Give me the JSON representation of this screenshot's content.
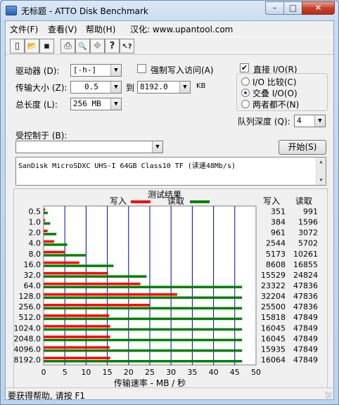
{
  "window": {
    "title": "无标题 - ATTO Disk Benchmark"
  },
  "menu": [
    "文件(F)",
    "查看(V)",
    "帮助(H)",
    "汉化: www.upantool.com"
  ],
  "toolbar": [
    {
      "name": "new-icon",
      "glyph": "▯"
    },
    {
      "name": "open-icon",
      "glyph": "📂"
    },
    {
      "name": "save-icon",
      "glyph": "▪"
    },
    {
      "name": "print-icon",
      "glyph": "⎙"
    },
    {
      "name": "print-preview-icon",
      "glyph": "🔍"
    },
    {
      "name": "move-icon",
      "glyph": "✥"
    },
    {
      "name": "help-icon",
      "glyph": "?"
    },
    {
      "name": "context-help-icon",
      "glyph": "↖?"
    }
  ],
  "settings": {
    "drive_label": "驱动器 (D):",
    "drive_value": "[-h-]",
    "force_write_label": "强制写入访问(A)",
    "force_write_checked": false,
    "transfer_label": "传输大小 (Z):",
    "transfer_from": "0.5",
    "to_label": "到",
    "transfer_to": "8192.0",
    "kb_label": "KB",
    "length_label": "总长度 (L):",
    "length_value": "256 MB",
    "direct_io_label": "直接 I/O(R)",
    "direct_io_checked": true,
    "io_compare_label": "I/O 比较(C)",
    "overlap_io_label": "交叠 I/O(O)",
    "neither_label": "两者都不(N)",
    "selected_io_mode": "overlap",
    "queue_label": "队列深度 (Q):",
    "queue_value": "4",
    "controlled_by_label": "受控制于 (B):",
    "controlled_by_value": "",
    "start_button": "开始(S)",
    "description": "SanDisk MicroSDXC UHS-I 64GB Class10 TF (读速48Mb/s)"
  },
  "results": {
    "group_title": "测试结果",
    "legend_write": "写入",
    "legend_read": "读取",
    "col_write": "写入",
    "col_read": "读取",
    "colors": {
      "write": "#ff0000",
      "read": "#008000",
      "grid": "#0000a0"
    }
  },
  "chart_data": {
    "type": "bar",
    "orientation": "horizontal",
    "categories": [
      "0.5",
      "1.0",
      "2.0",
      "4.0",
      "8.0",
      "16.0",
      "32.0",
      "64.0",
      "128.0",
      "256.0",
      "512.0",
      "1024.0",
      "2048.0",
      "4096.0",
      "8192.0"
    ],
    "series": [
      {
        "name": "写入",
        "values": [
          351,
          384,
          961,
          2544,
          5173,
          8608,
          15529,
          23322,
          32204,
          25500,
          15818,
          16045,
          16045,
          15935,
          16064
        ]
      },
      {
        "name": "读取",
        "values": [
          991,
          1596,
          3072,
          5702,
          10261,
          16855,
          24824,
          47836,
          47836,
          47836,
          47849,
          47849,
          47849,
          47849,
          47849
        ]
      }
    ],
    "xlabel": "传输速率 - MB / 秒",
    "xticks": [
      "0",
      "5",
      "10",
      "15",
      "20",
      "25",
      "30",
      "35",
      "40",
      "45",
      "50"
    ],
    "xlim": [
      0,
      50
    ],
    "grid": true,
    "legend": "top"
  },
  "status": {
    "text": "要获得帮助, 请按 F1"
  }
}
